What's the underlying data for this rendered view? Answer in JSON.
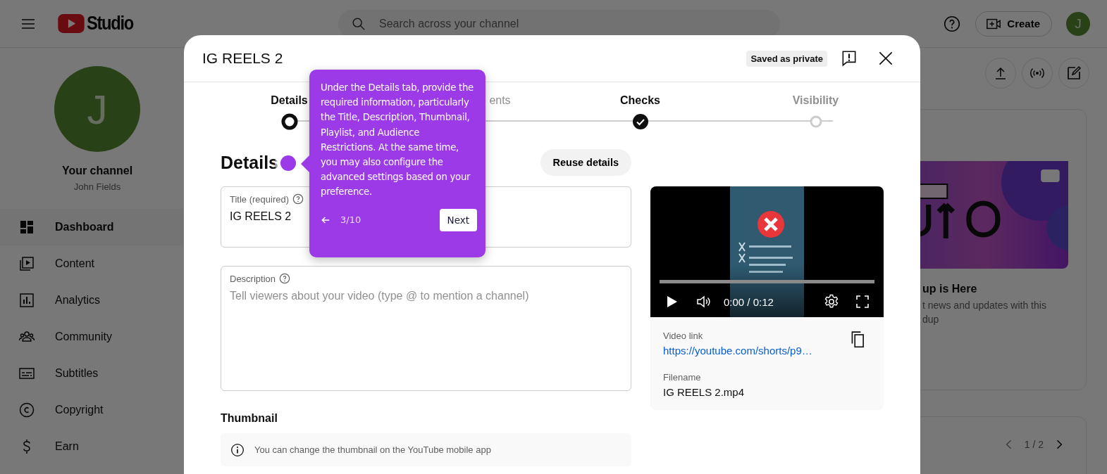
{
  "header": {
    "logo_text": "Studio",
    "search": {
      "placeholder": "Search across your channel"
    },
    "create_label": "Create",
    "avatar_initial": "J"
  },
  "sidebar": {
    "avatar_initial": "J",
    "channel_title": "Your channel",
    "channel_name": "John Fields",
    "items": [
      {
        "label": "Dashboard",
        "selected": true
      },
      {
        "label": "Content",
        "selected": false
      },
      {
        "label": "Analytics",
        "selected": false
      },
      {
        "label": "Community",
        "selected": false
      },
      {
        "label": "Subtitles",
        "selected": false
      },
      {
        "label": "Copyright",
        "selected": false
      },
      {
        "label": "Earn",
        "selected": false
      }
    ]
  },
  "dashboard": {
    "card": {
      "title": "up is Here",
      "description": "t news and updates with this",
      "description_2": "dup"
    },
    "pager": "1 / 2"
  },
  "modal": {
    "title": "IG REELS 2",
    "status_badge": "Saved as private",
    "steps": [
      {
        "label": "Details",
        "kind": "current"
      },
      {
        "label": "ents",
        "kind": "hidden"
      },
      {
        "label": "Checks",
        "kind": "done"
      },
      {
        "label": "Visibility",
        "kind": "pending"
      }
    ],
    "heading": "Details",
    "reuse_button": "Reuse details",
    "title_field": {
      "label": "Title (required)",
      "value": "IG REELS 2"
    },
    "description_field": {
      "label": "Description",
      "placeholder": "Tell viewers about your video (type @ to mention a channel)"
    },
    "thumbnail": {
      "heading": "Thumbnail",
      "note": "You can change the thumbnail on the YouTube mobile app"
    },
    "video": {
      "time": "0:00 / 0:12",
      "link_label": "Video link",
      "link": "https://youtube.com/shorts/p9…",
      "filename_label": "Filename",
      "filename": "IG REELS 2.mp4"
    }
  },
  "tooltip": {
    "text": "Under the Details tab, provide the required information, particularly the Title, Description, Thumbnail, Playlist, and Audience Restrictions. At the same time, you may also configure the advanced settings based on your preference.",
    "progress": "3/10",
    "next_button": "Next"
  }
}
